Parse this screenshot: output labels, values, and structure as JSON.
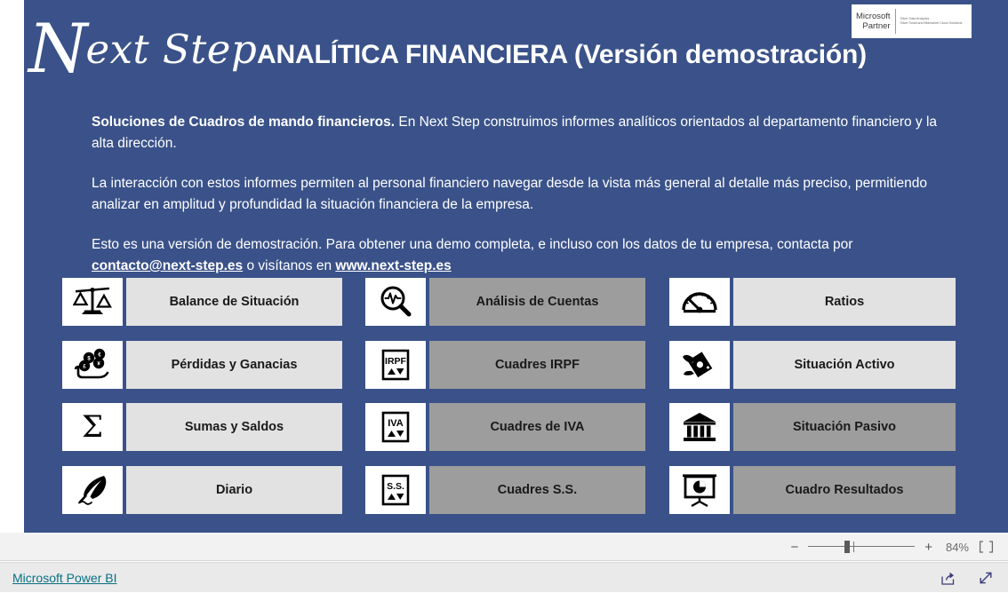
{
  "header": {
    "brand_initial": "N",
    "brand_rest": "ext Step",
    "title": "ANALÍTICA FINANCIERA (Versión demostración)",
    "partner_badge": {
      "line1": "Microsoft",
      "line2": "Partner",
      "competency1": "Silver Data Analytics",
      "competency2": "Silver Small and Midmarket Cloud Solutions"
    }
  },
  "intro": {
    "p1_lead": "Soluciones de Cuadros de mando financieros.",
    "p1_rest": " En Next Step construimos informes analíticos orientados al departamento financiero y la alta dirección.",
    "p2": "La interacción con estos informes permiten al personal financiero navegar desde la vista más general al detalle más preciso, permitiendo analizar en amplitud y profundidad la situación financiera de la empresa.",
    "p3_before": "Esto es una versión de demostración. Para obtener una demo completa, e incluso con los datos de tu empresa, contacta por ",
    "email": "contacto@next-step.es",
    "p3_middle": " o visítanos en ",
    "website": "www.next-step.es"
  },
  "tiles": [
    {
      "label": "Balance de Situación",
      "icon": "balance-scale-icon",
      "state": "enabled"
    },
    {
      "label": "Pérdidas y Ganacias",
      "icon": "hand-coins-icon",
      "state": "enabled"
    },
    {
      "label": "Sumas y Saldos",
      "icon": "sigma-icon",
      "state": "enabled"
    },
    {
      "label": "Diario",
      "icon": "quill-pen-icon",
      "state": "enabled"
    },
    {
      "label": "Análisis de Cuentas",
      "icon": "magnifier-pulse-icon",
      "state": "disabled"
    },
    {
      "label": "Cuadres IRPF",
      "icon": "irpf-box-icon",
      "state": "disabled",
      "badge": "IRPF"
    },
    {
      "label": "Cuadres de IVA",
      "icon": "iva-box-icon",
      "state": "disabled",
      "badge": "IVA"
    },
    {
      "label": "Cuadres S.S.",
      "icon": "ss-box-icon",
      "state": "disabled",
      "badge": "S.S."
    },
    {
      "label": "Ratios",
      "icon": "gauge-icon",
      "state": "enabled"
    },
    {
      "label": "Situación Activo",
      "icon": "flying-money-icon",
      "state": "enabled"
    },
    {
      "label": "Situación Pasivo",
      "icon": "bank-building-icon",
      "state": "disabled"
    },
    {
      "label": "Cuadro Resultados",
      "icon": "presentation-pie-icon",
      "state": "disabled"
    }
  ],
  "zoom_bar": {
    "zoom_out": "−",
    "zoom_in": "+",
    "level": "84%",
    "fit_icon": "fit-to-page-icon"
  },
  "footer": {
    "powerbi_label": "Microsoft Power BI",
    "share_icon": "share-icon",
    "fullscreen_icon": "fullscreen-icon"
  },
  "colors": {
    "page_background": "#3A5289",
    "tile_enabled": "#E2E2E2",
    "tile_disabled": "#9D9D9D",
    "icon_background": "#FFFFFF",
    "link": "#086F83"
  }
}
